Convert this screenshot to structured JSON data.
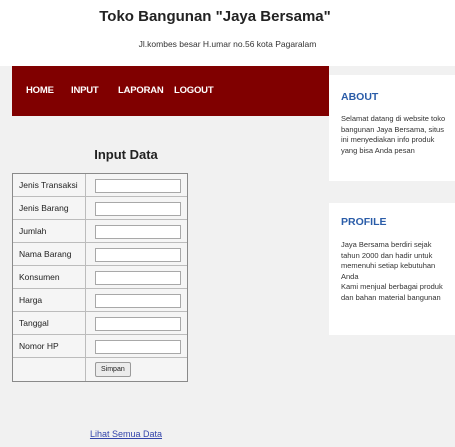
{
  "header": {
    "title": "Toko Bangunan \"Jaya Bersama\"",
    "address": "Jl.kombes besar H.umar no.56 kota Pagaralam"
  },
  "nav": {
    "items": [
      "HOME",
      "INPUT",
      "LAPORAN",
      "LOGOUT"
    ],
    "background": "#800000"
  },
  "form": {
    "title": "Input Data",
    "fields": [
      {
        "label": "Jenis Transaksi",
        "value": ""
      },
      {
        "label": "Jenis Barang",
        "value": ""
      },
      {
        "label": "Jumlah",
        "value": ""
      },
      {
        "label": "Nama Barang",
        "value": ""
      },
      {
        "label": "Konsumen",
        "value": ""
      },
      {
        "label": "Harga",
        "value": ""
      },
      {
        "label": "Tanggal",
        "value": ""
      },
      {
        "label": "Nomor HP",
        "value": ""
      }
    ],
    "submit_label": "Simpan",
    "view_all_link": "Lihat Semua Data"
  },
  "sidebar": {
    "about": {
      "heading": "ABOUT",
      "text": "Selamat datang di website toko bangunan Jaya Bersama, situs ini menyediakan info produk yang bisa Anda pesan"
    },
    "profile": {
      "heading": "PROFILE",
      "paragraphs": [
        "Jaya Bersama berdiri sejak tahun 2000 dan hadir untuk memenuhi setiap kebutuhan Anda",
        "Kami menjual berbagai produk dan bahan material bangunan"
      ]
    },
    "heading_color": "#2a5ca8"
  },
  "colors": {
    "nav": "#800000",
    "link": "#3344aa",
    "page_bg": "#f1f1f1"
  }
}
